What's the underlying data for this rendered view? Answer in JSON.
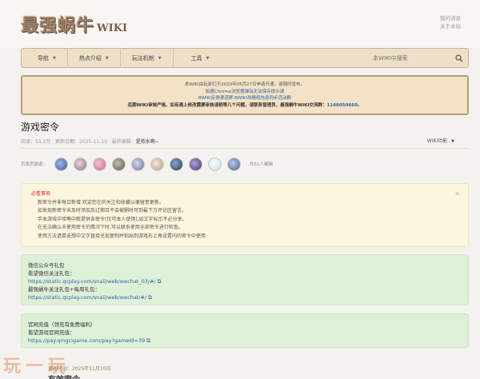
{
  "header": {
    "logo_text": "最强蜗牛",
    "logo_suffix": "WIKI",
    "user_links": [
      "我的消息",
      "关于本站"
    ]
  },
  "nav": {
    "items": [
      {
        "label": "导航"
      },
      {
        "label": "热点介绍"
      },
      {
        "label": "玩法机制"
      },
      {
        "label": "工具"
      }
    ],
    "search_placeholder": "本WIKI中搜索"
  },
  "notice": {
    "line1": "本WIKI由玩家们于2020年05月27日申请开通，请随时发布。",
    "line2": "如遇Chrome浏览器弹出无法保存提示请",
    "line3": "BWIKI反馈渠道群 BWIKI攻略组信息同步活动群",
    "line4": "迄期WIKI审核严格，如有遇上修改需要审核请稍等几个问题，请联系管理员，最强蜗牛WIKI交流群：",
    "qq": "1148050660。"
  },
  "page": {
    "title": "游戏密令",
    "views_label": "阅读：",
    "views": "55.2万",
    "updated_label": "更新日期：",
    "updated": "2025-11-10",
    "editor_label": "最终编辑：",
    "editor": "是热水啊~",
    "wiki_func": "WIKI功能"
  },
  "contributors": {
    "label": "页面贡献者：",
    "count": "共51人编辑"
  },
  "tip": {
    "title": "必看事项",
    "line1": "新密令并非每日新增,欢迎您在的关注和收藏以便留意更新。",
    "line2": "如发现新密令未及时添加及过期且不会被删时可到最下方评论区留言。",
    "line3": "手本游戏中攻略中新提供各密令(仅可本人使用),如文字标示不必分享。",
    "line4": "在无法确认未使用密令的情况下时,可以联系使用全部密令进行检查。",
    "line5": "使用方法请单击想中文字直接兑现复制并粘贴到游戏右上角设置内的密令中使用"
  },
  "wechat_box": {
    "title": "微信公众号礼包",
    "line1": "看望微信关注礼包：",
    "link1": "https://static.qcplay.com/snail/web/wechat_03/#/",
    "line2": "最强蜗牛关注礼包+每周礼包：",
    "link2": "https://static.qcplay.com/snail/web/wechat/#/"
  },
  "recharge_box": {
    "title": "官网充值（领充有免费福利）",
    "line1": "看望游戏官网充值：",
    "link1": "https://pay.qingcigame.com/pay?gameId=39"
  },
  "footer": {
    "watermark": "玩一玩",
    "date_line": "更新时间：2025年11月10日",
    "section_title": "有效密令"
  },
  "colors": {
    "nav_bg": "#eedfc8",
    "notice_bg": "#f3e2c6",
    "tip_bg": "#fcf6de",
    "green_bg": "#def1d8",
    "link": "#2a63a8",
    "warn_red": "#e1322b"
  },
  "icons": [
    "search-icon",
    "caret-down-icon",
    "close-icon",
    "copy-icon"
  ]
}
